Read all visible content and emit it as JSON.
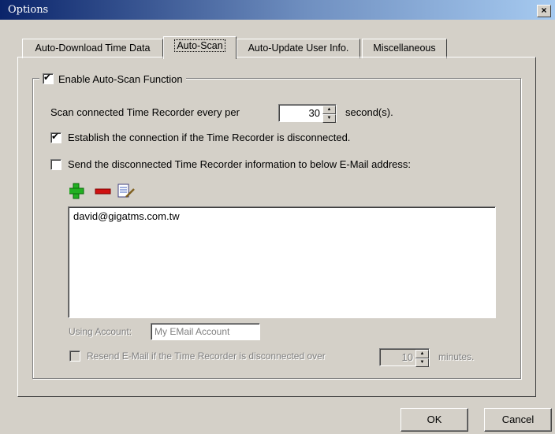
{
  "window": {
    "title": "Options",
    "close_glyph": "×"
  },
  "tabs": [
    {
      "label": "Auto-Download Time Data"
    },
    {
      "label": "Auto-Scan"
    },
    {
      "label": "Auto-Update User Info."
    },
    {
      "label": "Miscellaneous"
    }
  ],
  "autoscan": {
    "enable_label": "Enable Auto-Scan Function",
    "enable_checked": true,
    "scan_label": "Scan connected Time Recorder every per",
    "scan_value": "30",
    "scan_unit": "second(s).",
    "establish_label": "Establish the connection if the Time Recorder is disconnected.",
    "establish_checked": true,
    "send_label": "Send the disconnected Time Recorder information to below E-Mail address:",
    "send_checked": false,
    "emails": [
      "david@gigatms.com.tw"
    ],
    "toolbar_icons": [
      "add-icon",
      "remove-icon",
      "edit-icon"
    ],
    "account_label": "Using Account:",
    "account_value": "My EMail Account",
    "resend_label": "Resend E-Mail if the Time Recorder is disconnected over",
    "resend_value": "10",
    "resend_unit": "minutes.",
    "resend_checked": false
  },
  "buttons": {
    "ok": "OK",
    "cancel": "Cancel"
  },
  "colors": {
    "titlebar_start": "#0a246a",
    "titlebar_end": "#a6caf0",
    "face": "#d4d0c8",
    "add_icon": "#22b022",
    "remove_icon": "#d01010"
  }
}
